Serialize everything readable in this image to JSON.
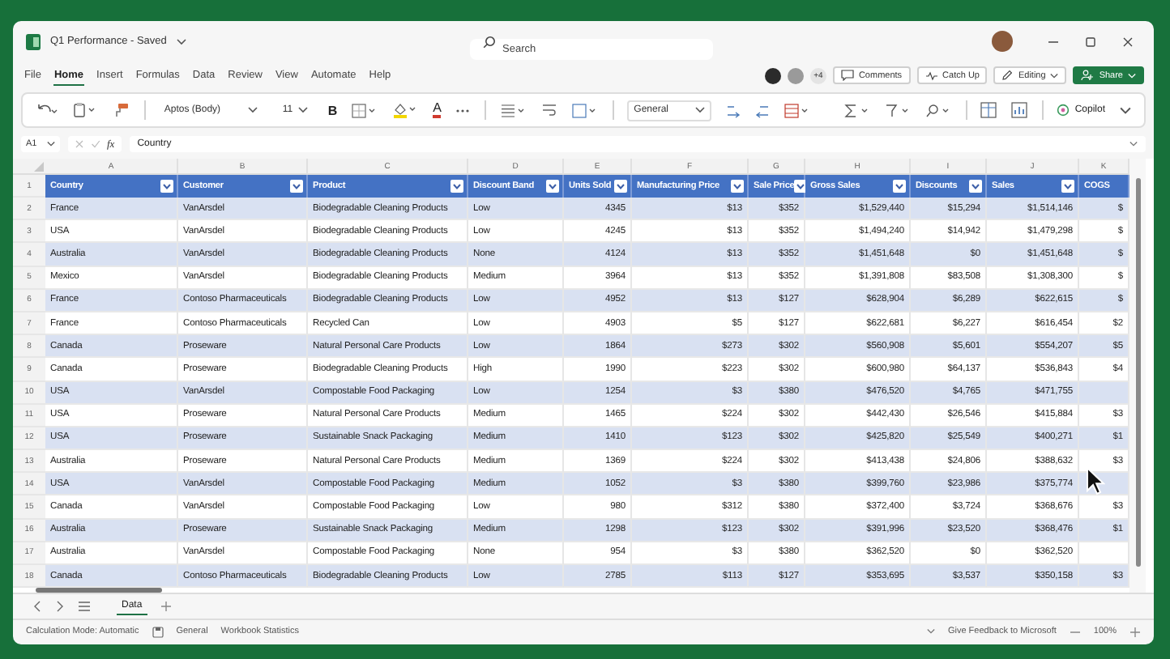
{
  "window": {
    "title": "Q1 Performance - Saved",
    "search": {
      "placeholder": "Search"
    }
  },
  "menu": [
    {
      "label": "File",
      "selected": false
    },
    {
      "label": "Home",
      "selected": true
    },
    {
      "label": "Insert",
      "selected": false
    },
    {
      "label": "Formulas",
      "selected": false
    },
    {
      "label": "Data",
      "selected": false
    },
    {
      "label": "Review",
      "selected": false
    },
    {
      "label": "View",
      "selected": false
    },
    {
      "label": "Automate",
      "selected": false
    },
    {
      "label": "Help",
      "selected": false
    }
  ],
  "collab": {
    "extra_count": "+4",
    "comments": "Comments",
    "catch_up": "Catch Up",
    "editing": "Editing",
    "share": "Share"
  },
  "ribbon": {
    "font": "Aptos (Body)",
    "size": "11",
    "bold": "B",
    "font_color": "A",
    "number_format": "General",
    "copilot": "Copilot"
  },
  "formula_bar": {
    "cell": "A1",
    "fx": "fx",
    "value": "Country"
  },
  "columns": [
    "A",
    "B",
    "C",
    "D",
    "E",
    "F",
    "G",
    "H",
    "I",
    "J",
    "K"
  ],
  "table": {
    "header_row": "1",
    "headers": [
      "Country",
      "Customer",
      "Product",
      "Discount Band",
      "Units Sold",
      "Manufacturing Price",
      "Sale Price",
      "Gross Sales",
      "Discounts",
      "Sales",
      "COGS"
    ],
    "rows": [
      {
        "number": "2",
        "cells": [
          "France",
          "VanArsdel",
          "Biodegradable Cleaning Products",
          "Low",
          "4345",
          "$13",
          "$352",
          "$1,529,440",
          "$15,294",
          "$1,514,146",
          "$"
        ]
      },
      {
        "number": "3",
        "cells": [
          "USA",
          "VanArsdel",
          "Biodegradable Cleaning Products",
          "Low",
          "4245",
          "$13",
          "$352",
          "$1,494,240",
          "$14,942",
          "$1,479,298",
          "$"
        ]
      },
      {
        "number": "4",
        "cells": [
          "Australia",
          "VanArsdel",
          "Biodegradable Cleaning Products",
          "None",
          "4124",
          "$13",
          "$352",
          "$1,451,648",
          "$0",
          "$1,451,648",
          "$"
        ]
      },
      {
        "number": "5",
        "cells": [
          "Mexico",
          "VanArsdel",
          "Biodegradable Cleaning Products",
          "Medium",
          "3964",
          "$13",
          "$352",
          "$1,391,808",
          "$83,508",
          "$1,308,300",
          "$"
        ]
      },
      {
        "number": "6",
        "cells": [
          "France",
          "Contoso Pharmaceuticals",
          "Biodegradable Cleaning Products",
          "Low",
          "4952",
          "$13",
          "$127",
          "$628,904",
          "$6,289",
          "$622,615",
          "$"
        ]
      },
      {
        "number": "7",
        "cells": [
          "France",
          "Contoso Pharmaceuticals",
          "Recycled Can",
          "Low",
          "4903",
          "$5",
          "$127",
          "$622,681",
          "$6,227",
          "$616,454",
          "$2"
        ]
      },
      {
        "number": "8",
        "cells": [
          "Canada",
          "Proseware",
          "Natural Personal Care Products",
          "Low",
          "1864",
          "$273",
          "$302",
          "$560,908",
          "$5,601",
          "$554,207",
          "$5"
        ]
      },
      {
        "number": "9",
        "cells": [
          "Canada",
          "Proseware",
          "Biodegradable Cleaning Products",
          "High",
          "1990",
          "$223",
          "$302",
          "$600,980",
          "$64,137",
          "$536,843",
          "$4"
        ]
      },
      {
        "number": "10",
        "cells": [
          "USA",
          "VanArsdel",
          "Compostable Food Packaging",
          "Low",
          "1254",
          "$3",
          "$380",
          "$476,520",
          "$4,765",
          "$471,755"
        ]
      },
      {
        "number": "11",
        "cells": [
          "USA",
          "Proseware",
          "Natural Personal Care Products",
          "Medium",
          "1465",
          "$224",
          "$302",
          "$442,430",
          "$26,546",
          "$415,884",
          "$3"
        ]
      },
      {
        "number": "12",
        "cells": [
          "USA",
          "Proseware",
          "Sustainable Snack Packaging",
          "Medium",
          "1410",
          "$123",
          "$302",
          "$425,820",
          "$25,549",
          "$400,271",
          "$1"
        ]
      },
      {
        "number": "13",
        "cells": [
          "Australia",
          "Proseware",
          "Natural Personal Care Products",
          "Medium",
          "1369",
          "$224",
          "$302",
          "$413,438",
          "$24,806",
          "$388,632",
          "$3"
        ]
      },
      {
        "number": "14",
        "cells": [
          "USA",
          "VanArsdel",
          "Compostable Food Packaging",
          "Medium",
          "1052",
          "$3",
          "$380",
          "$399,760",
          "$23,986",
          "$375,774"
        ]
      },
      {
        "number": "15",
        "cells": [
          "Canada",
          "VanArsdel",
          "Compostable Food Packaging",
          "Low",
          "980",
          "$312",
          "$380",
          "$372,400",
          "$3,724",
          "$368,676",
          "$3"
        ]
      },
      {
        "number": "16",
        "cells": [
          "Australia",
          "Proseware",
          "Sustainable Snack Packaging",
          "Medium",
          "1298",
          "$123",
          "$302",
          "$391,996",
          "$23,520",
          "$368,476",
          "$1"
        ]
      },
      {
        "number": "17",
        "cells": [
          "Australia",
          "VanArsdel",
          "Compostable Food Packaging",
          "None",
          "954",
          "$3",
          "$380",
          "$362,520",
          "$0",
          "$362,520"
        ]
      },
      {
        "number": "18",
        "cells": [
          "Canada",
          "Contoso Pharmaceuticals",
          "Biodegradable Cleaning Products",
          "Low",
          "2785",
          "$113",
          "$127",
          "$353,695",
          "$3,537",
          "$350,158",
          "$3"
        ]
      }
    ]
  },
  "sheet_tabs": [
    {
      "label": "Data",
      "selected": true
    }
  ],
  "status_bar": {
    "calculation": "Calculation Mode: Automatic",
    "format": "General",
    "statistics": "Workbook Statistics",
    "feedback": "Give Feedback to Microsoft",
    "zoom": "100%"
  }
}
